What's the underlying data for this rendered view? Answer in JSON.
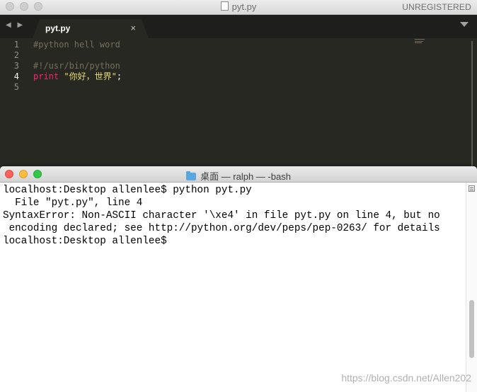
{
  "sublime": {
    "window_title": "pyt.py",
    "unregistered": "UNREGISTERED",
    "tab_label": "pyt.py",
    "tab_close": "×",
    "nav_arrows": "◀ ▶",
    "line_numbers": [
      "1",
      "2",
      "3",
      "4",
      "5"
    ],
    "code": {
      "line1": "#python hell word",
      "line3": "#!/usr/bin/python",
      "line4_keyword": "print",
      "line4_string": "\"你好，世界\"",
      "line4_end": ";"
    }
  },
  "terminal": {
    "title": "桌面 — ralph — -bash",
    "lines": [
      "localhost:Desktop allenlee$ python pyt.py",
      "  File \"pyt.py\", line 4",
      "SyntaxError: Non-ASCII character '\\xe4' in file pyt.py on line 4, but no",
      " encoding declared; see http://python.org/dev/peps/pep-0263/ for details",
      "localhost:Desktop allenlee$ "
    ]
  },
  "watermark": "https://blog.csdn.net/Allen202"
}
